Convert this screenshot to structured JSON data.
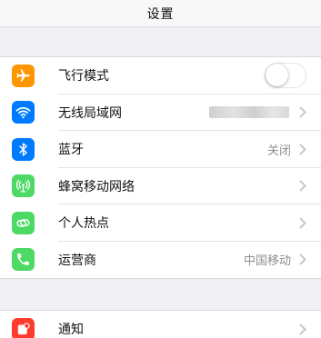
{
  "nav": {
    "title": "设置"
  },
  "group1": {
    "rows": [
      {
        "label": "飞行模式",
        "icon": "airplane-icon",
        "icon_color": "#ff9500",
        "control": "toggle",
        "toggle_on": false
      },
      {
        "label": "无线局域网",
        "icon": "wifi-icon",
        "icon_color": "#007aff",
        "control": "chevron",
        "value_redacted": true
      },
      {
        "label": "蓝牙",
        "icon": "bluetooth-icon",
        "icon_color": "#007aff",
        "control": "chevron",
        "value": "关闭"
      },
      {
        "label": "蜂窝移动网络",
        "icon": "cellular-icon",
        "icon_color": "#4cd964",
        "control": "chevron"
      },
      {
        "label": "个人热点",
        "icon": "hotspot-icon",
        "icon_color": "#4cd964",
        "control": "chevron"
      },
      {
        "label": "运营商",
        "icon": "phone-icon",
        "icon_color": "#4cd964",
        "control": "chevron",
        "value": "中国移动"
      }
    ]
  },
  "group2": {
    "rows": [
      {
        "label": "通知",
        "icon": "notifications-icon",
        "icon_color": "#ff3b30",
        "control": "chevron"
      }
    ]
  }
}
